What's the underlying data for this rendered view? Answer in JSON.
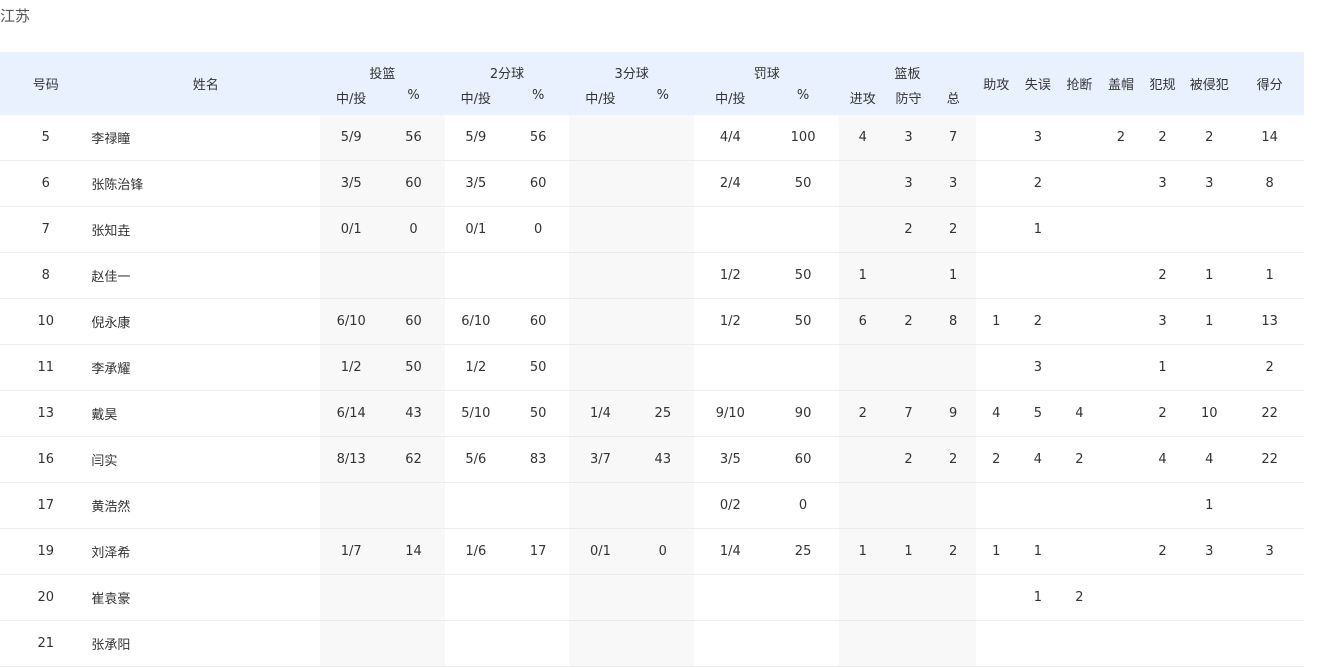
{
  "team": "江苏",
  "headers": {
    "num": "号码",
    "name": "姓名",
    "fg": "投篮",
    "two": "2分球",
    "three": "3分球",
    "ft": "罚球",
    "reb": "篮板",
    "made_att": "中/投",
    "pct": "%",
    "off": "进攻",
    "def": "防守",
    "tot": "总",
    "ast": "助攻",
    "tov": "失误",
    "stl": "抢断",
    "blk": "盖帽",
    "pf": "犯规",
    "fd": "被侵犯",
    "pts": "得分"
  },
  "players": [
    {
      "num": "5",
      "name": "李禄瞳",
      "fg": "5/9",
      "fg_pct": "56",
      "two": "5/9",
      "two_pct": "56",
      "three": "",
      "three_pct": "",
      "ft": "4/4",
      "ft_pct": "100",
      "off": "4",
      "def": "3",
      "tot": "7",
      "ast": "",
      "tov": "3",
      "stl": "",
      "blk": "2",
      "pf": "2",
      "fd": "2",
      "pts": "14"
    },
    {
      "num": "6",
      "name": "张陈治锋",
      "fg": "3/5",
      "fg_pct": "60",
      "two": "3/5",
      "two_pct": "60",
      "three": "",
      "three_pct": "",
      "ft": "2/4",
      "ft_pct": "50",
      "off": "",
      "def": "3",
      "tot": "3",
      "ast": "",
      "tov": "2",
      "stl": "",
      "blk": "",
      "pf": "3",
      "fd": "3",
      "pts": "8"
    },
    {
      "num": "7",
      "name": "张知垚",
      "fg": "0/1",
      "fg_pct": "0",
      "two": "0/1",
      "two_pct": "0",
      "three": "",
      "three_pct": "",
      "ft": "",
      "ft_pct": "",
      "off": "",
      "def": "2",
      "tot": "2",
      "ast": "",
      "tov": "1",
      "stl": "",
      "blk": "",
      "pf": "",
      "fd": "",
      "pts": ""
    },
    {
      "num": "8",
      "name": "赵佳一",
      "fg": "",
      "fg_pct": "",
      "two": "",
      "two_pct": "",
      "three": "",
      "three_pct": "",
      "ft": "1/2",
      "ft_pct": "50",
      "off": "1",
      "def": "",
      "tot": "1",
      "ast": "",
      "tov": "",
      "stl": "",
      "blk": "",
      "pf": "2",
      "fd": "1",
      "pts": "1"
    },
    {
      "num": "10",
      "name": "倪永康",
      "fg": "6/10",
      "fg_pct": "60",
      "two": "6/10",
      "two_pct": "60",
      "three": "",
      "three_pct": "",
      "ft": "1/2",
      "ft_pct": "50",
      "off": "6",
      "def": "2",
      "tot": "8",
      "ast": "1",
      "tov": "2",
      "stl": "",
      "blk": "",
      "pf": "3",
      "fd": "1",
      "pts": "13"
    },
    {
      "num": "11",
      "name": "李承耀",
      "fg": "1/2",
      "fg_pct": "50",
      "two": "1/2",
      "two_pct": "50",
      "three": "",
      "three_pct": "",
      "ft": "",
      "ft_pct": "",
      "off": "",
      "def": "",
      "tot": "",
      "ast": "",
      "tov": "3",
      "stl": "",
      "blk": "",
      "pf": "1",
      "fd": "",
      "pts": "2"
    },
    {
      "num": "13",
      "name": "戴昊",
      "fg": "6/14",
      "fg_pct": "43",
      "two": "5/10",
      "two_pct": "50",
      "three": "1/4",
      "three_pct": "25",
      "ft": "9/10",
      "ft_pct": "90",
      "off": "2",
      "def": "7",
      "tot": "9",
      "ast": "4",
      "tov": "5",
      "stl": "4",
      "blk": "",
      "pf": "2",
      "fd": "10",
      "pts": "22"
    },
    {
      "num": "16",
      "name": "闫实",
      "fg": "8/13",
      "fg_pct": "62",
      "two": "5/6",
      "two_pct": "83",
      "three": "3/7",
      "three_pct": "43",
      "ft": "3/5",
      "ft_pct": "60",
      "off": "",
      "def": "2",
      "tot": "2",
      "ast": "2",
      "tov": "4",
      "stl": "2",
      "blk": "",
      "pf": "4",
      "fd": "4",
      "pts": "22"
    },
    {
      "num": "17",
      "name": "黄浩然",
      "fg": "",
      "fg_pct": "",
      "two": "",
      "two_pct": "",
      "three": "",
      "three_pct": "",
      "ft": "0/2",
      "ft_pct": "0",
      "off": "",
      "def": "",
      "tot": "",
      "ast": "",
      "tov": "",
      "stl": "",
      "blk": "",
      "pf": "",
      "fd": "1",
      "pts": ""
    },
    {
      "num": "19",
      "name": "刘泽希",
      "fg": "1/7",
      "fg_pct": "14",
      "two": "1/6",
      "two_pct": "17",
      "three": "0/1",
      "three_pct": "0",
      "ft": "1/4",
      "ft_pct": "25",
      "off": "1",
      "def": "1",
      "tot": "2",
      "ast": "1",
      "tov": "1",
      "stl": "",
      "blk": "",
      "pf": "2",
      "fd": "3",
      "pts": "3"
    },
    {
      "num": "20",
      "name": "崔袁豪",
      "fg": "",
      "fg_pct": "",
      "two": "",
      "two_pct": "",
      "three": "",
      "three_pct": "",
      "ft": "",
      "ft_pct": "",
      "off": "",
      "def": "",
      "tot": "",
      "ast": "",
      "tov": "1",
      "stl": "2",
      "blk": "",
      "pf": "",
      "fd": "",
      "pts": ""
    },
    {
      "num": "21",
      "name": "张承阳",
      "fg": "",
      "fg_pct": "",
      "two": "",
      "two_pct": "",
      "three": "",
      "three_pct": "",
      "ft": "",
      "ft_pct": "",
      "off": "",
      "def": "",
      "tot": "",
      "ast": "",
      "tov": "",
      "stl": "",
      "blk": "",
      "pf": "",
      "fd": "",
      "pts": ""
    }
  ]
}
